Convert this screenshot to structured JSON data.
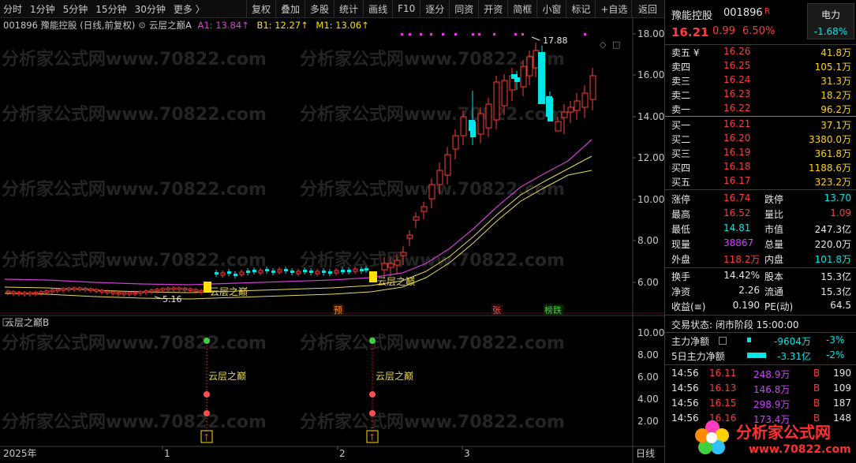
{
  "toolbar": {
    "periods": [
      "分时",
      "1分钟",
      "5分钟",
      "15分钟",
      "30分钟",
      "更多 〉"
    ],
    "tools": [
      "复权",
      "叠加",
      "多股",
      "统计",
      "画线",
      "F10",
      "逐分",
      "同资",
      "开资",
      "简框",
      "小窗",
      "标记",
      "+自选"
    ],
    "back_label": "返回"
  },
  "chart": {
    "info_code": "001896 豫能控股 (日线,前复权)",
    "indicator_name": "云层之巅A",
    "a1": "A1: 13.84↑",
    "b1": "B1: 12.27↑",
    "m1": "M1: 13.06↑",
    "high_label": "17.88",
    "low_label": "5.16",
    "y_ticks": [
      "18.00",
      "16.00",
      "14.00",
      "12.00",
      "10.00",
      "8.00",
      "6.00"
    ],
    "signal_text": "云层之巅",
    "event_tags": [
      "预",
      "张",
      "榜跌"
    ],
    "sub_title": "云层之巅B",
    "sub_ticks": [
      "10.00",
      "8.00",
      "6.00",
      "4.00",
      "2.00"
    ],
    "x_labels": [
      "2025年",
      "1",
      "2",
      "3"
    ],
    "period_label": "日线",
    "watermark": "分析家公式网www.70822.com"
  },
  "panel": {
    "name": "豫能控股",
    "code": "001896",
    "r_mark": "R",
    "sector": "电力",
    "sector_change": "-1.68%",
    "price": "16.21",
    "change": "0.99",
    "change_pct": "6.50%",
    "asks": [
      {
        "label": "卖五 ¥",
        "price": "16.26",
        "vol": "41.8万"
      },
      {
        "label": "卖四",
        "price": "16.25",
        "vol": "105.1万"
      },
      {
        "label": "卖三",
        "price": "16.24",
        "vol": "31.3万"
      },
      {
        "label": "卖二",
        "price": "16.23",
        "vol": "18.2万"
      },
      {
        "label": "卖一",
        "price": "16.22",
        "vol": "96.2万"
      }
    ],
    "bids": [
      {
        "label": "买一",
        "price": "16.21",
        "vol": "37.1万"
      },
      {
        "label": "买二",
        "price": "16.20",
        "vol": "3380.0万"
      },
      {
        "label": "买三",
        "price": "16.19",
        "vol": "361.8万"
      },
      {
        "label": "买四",
        "price": "16.18",
        "vol": "1188.6万"
      },
      {
        "label": "买五",
        "price": "16.17",
        "vol": "323.2万"
      }
    ],
    "stats": [
      {
        "k1": "涨停",
        "v1": "16.74",
        "c1": "red",
        "k2": "跌停",
        "v2": "13.70",
        "c2": "cyan"
      },
      {
        "k1": "最高",
        "v1": "16.52",
        "c1": "red",
        "k2": "量比",
        "v2": "1.09",
        "c2": "red"
      },
      {
        "k1": "最低",
        "v1": "14.81",
        "c1": "cyan",
        "k2": "市值",
        "v2": "247.3亿",
        "c2": "wht"
      },
      {
        "k1": "现量",
        "v1": "38867",
        "c1": "mag",
        "k2": "总量",
        "v2": "220.0万",
        "c2": "wht"
      },
      {
        "k1": "外盘",
        "v1": "118.2万",
        "c1": "red",
        "k2": "内盘",
        "v2": "101.8万",
        "c2": "cyan"
      }
    ],
    "stats2": [
      {
        "k1": "换手",
        "v1": "14.42%",
        "k2": "股本",
        "v2": "15.3亿"
      },
      {
        "k1": "净资",
        "v1": "2.26",
        "k2": "流通",
        "v2": "15.3亿"
      },
      {
        "k1": "收益(≡)",
        "v1": "0.190",
        "k2": "PE(动)",
        "v2": "64.5"
      }
    ],
    "trade_state": "交易状态: 闭市阶段 15:00:00",
    "main_flow_label": "主力净额",
    "main_flow": "-9604万",
    "main_flow_pct": "-3%",
    "main5_label": "5日主力净额",
    "main5": "-3.31亿",
    "main5_pct": "-2%",
    "ticks": [
      {
        "t": "14:56",
        "p": "16.11",
        "v": "248.9万",
        "bs": "B",
        "n": "190"
      },
      {
        "t": "14:56",
        "p": "16.13",
        "v": "146.8万",
        "bs": "B",
        "n": "109"
      },
      {
        "t": "14:56",
        "p": "16.15",
        "v": "298.9万",
        "bs": "B",
        "n": "187"
      },
      {
        "t": "14:56",
        "p": "16.16",
        "v": "173.4万",
        "bs": "B",
        "n": "148"
      }
    ],
    "logo_text": "分析家公式网",
    "logo_url": "www.70822.com"
  }
}
